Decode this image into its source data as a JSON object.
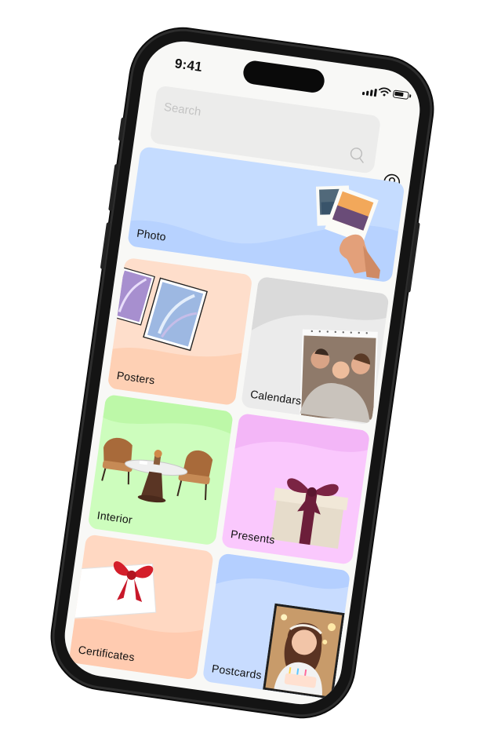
{
  "status_bar": {
    "time": "9:41"
  },
  "search": {
    "placeholder": "Search",
    "icon": "search-icon"
  },
  "profile": {
    "icon": "user-circle-icon"
  },
  "categories": [
    {
      "label": "Photo",
      "color": "#c5dcff"
    },
    {
      "label": "Posters",
      "color": "#fedecb"
    },
    {
      "label": "Calendars",
      "color": "#ebebeb"
    },
    {
      "label": "Interior",
      "color": "#cdfdbd"
    },
    {
      "label": "Presents",
      "color": "#fac8fd"
    },
    {
      "label": "Certificates",
      "color": "#ffd8c2"
    },
    {
      "label": "Postcards",
      "color": "#c8dcff"
    }
  ]
}
